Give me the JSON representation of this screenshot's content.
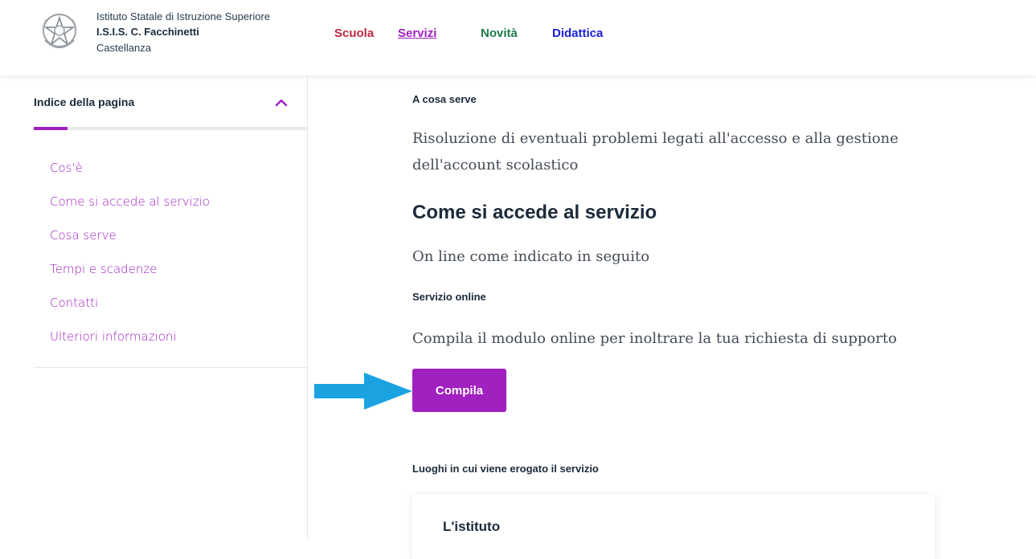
{
  "header": {
    "school_type": "Istituto Statale di Istruzione Superiore",
    "school_name": "I.S.I.S. C. Facchinetti",
    "school_city": "Castellanza",
    "emblem_icon": "republic-emblem-icon",
    "nav": {
      "scuola": "Scuola",
      "servizi": "Servizi",
      "novita": "Novità",
      "didattica": "Didattica"
    }
  },
  "sidebar": {
    "title": "Indice della pagina",
    "toggle_icon": "chevron-up-icon",
    "progress": 0.12,
    "items": [
      "Cos'è",
      "Come si accede al servizio",
      "Cosa serve",
      "Tempi e scadenze",
      "Contatti",
      "Ulteriori informazioni"
    ]
  },
  "main": {
    "a_cosa_serve_label": "A cosa serve",
    "a_cosa_serve_text": "Risoluzione di eventuali problemi legati all'accesso e alla gestione dell'account scolastico",
    "accesso_heading": "Come si accede al servizio",
    "accesso_text": "On line come indicato in seguito",
    "servizio_online_label": "Servizio online",
    "servizio_online_text": "Compila il modulo online per inoltrare la tua richiesta di supporto",
    "compila_button": "Compila",
    "luoghi_label": "Luoghi in cui viene erogato il servizio",
    "card_title": "L'istituto"
  },
  "colors": {
    "accent": "#a020c0",
    "scuola": "#c02640",
    "novita": "#1c7a4c",
    "didattica": "#1a20d8",
    "arrow": "#1aa3e0"
  }
}
